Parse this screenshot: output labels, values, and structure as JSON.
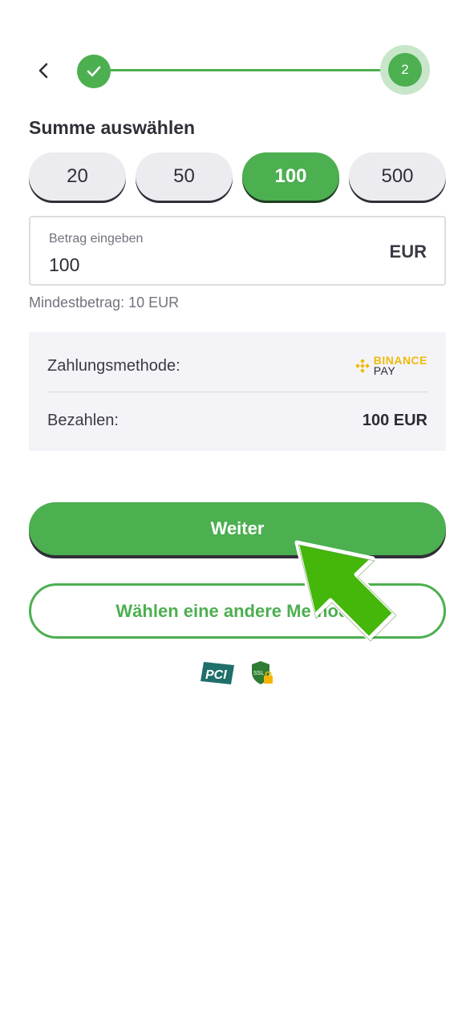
{
  "stepper": {
    "current_step": "2"
  },
  "section_title": "Summe auswählen",
  "amount_options": [
    "20",
    "50",
    "100",
    "500"
  ],
  "selected_amount": "100",
  "amount_input": {
    "label": "Betrag eingeben",
    "value": "100",
    "currency": "EUR"
  },
  "min_amount_text": "Mindestbetrag: 10 EUR",
  "summary": {
    "payment_method_label": "Zahlungsmethode:",
    "payment_method_logo": {
      "line1": "BINANCE",
      "line2": "PAY"
    },
    "pay_label": "Bezahlen:",
    "pay_value": "100 EUR"
  },
  "buttons": {
    "continue": "Weiter",
    "other_method": "Wählen eine andere Methode"
  },
  "badges": {
    "pci": "PCI",
    "ssl": "SSL"
  },
  "colors": {
    "accent": "#4caf50",
    "accent_light": "#c8e6c9",
    "binance": "#f0b90b",
    "pointer": "#44b70a"
  }
}
